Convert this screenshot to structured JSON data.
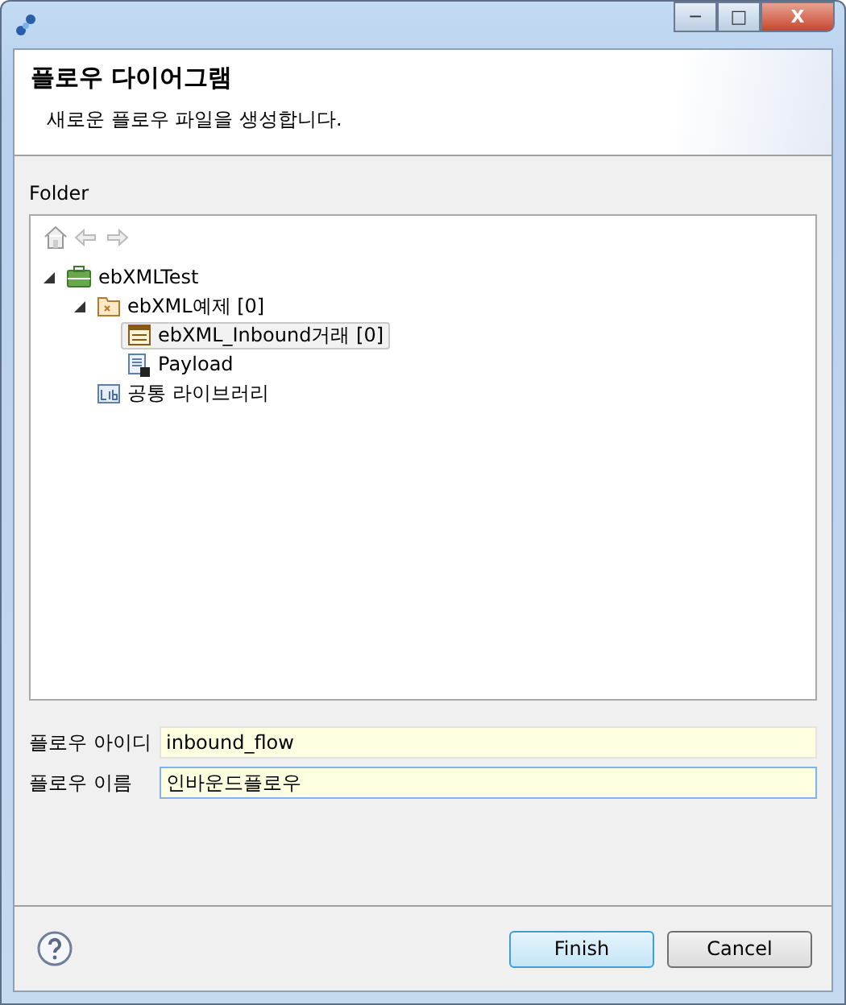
{
  "window": {
    "minimize": "─",
    "maximize": "□",
    "close": "X"
  },
  "header": {
    "title": "플로우 다이어그램",
    "description": "새로운 플로우 파일을 생성합니다."
  },
  "folder": {
    "label": "Folder",
    "tree": [
      {
        "label": "ebXMLTest",
        "kind": "project",
        "expanded": true,
        "selected": false,
        "children": [
          {
            "label": "ebXML예제 [0]",
            "kind": "package",
            "expanded": true,
            "selected": false,
            "children": [
              {
                "label": "ebXML_Inbound거래 [0]",
                "kind": "flow",
                "selected": true
              },
              {
                "label": "Payload",
                "kind": "payload",
                "selected": false
              }
            ]
          },
          {
            "label": "공통 라이브러리",
            "kind": "library",
            "selected": false
          }
        ]
      }
    ]
  },
  "fields": [
    {
      "label": "플로우 아이디",
      "value": "inbound_flow",
      "focused": false
    },
    {
      "label": "플로우 이름",
      "value": "인바운드플로우",
      "focused": true
    }
  ],
  "buttons": [
    {
      "label": "Finish",
      "default": true
    },
    {
      "label": "Cancel",
      "default": false
    }
  ]
}
